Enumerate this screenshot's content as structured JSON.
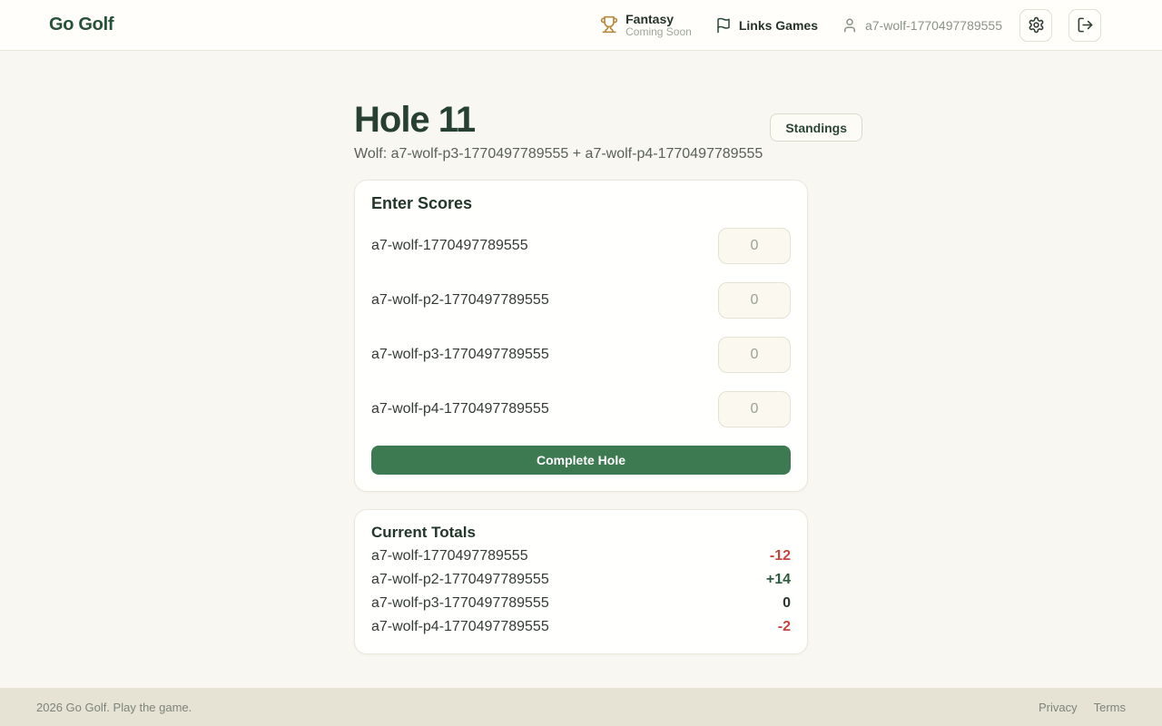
{
  "brand": "Go Golf",
  "nav": {
    "fantasy": {
      "label": "Fantasy",
      "sublabel": "Coming Soon"
    },
    "links_games_label": "Links Games",
    "user": "a7-wolf-1770497789555"
  },
  "page": {
    "title": "Hole 11",
    "subtitle": "Wolf: a7-wolf-p3-1770497789555 + a7-wolf-p4-1770497789555",
    "standings_label": "Standings"
  },
  "enter_scores": {
    "title": "Enter Scores",
    "submit_label": "Complete Hole",
    "players": [
      {
        "name": "a7-wolf-1770497789555",
        "placeholder": "0",
        "value": ""
      },
      {
        "name": "a7-wolf-p2-1770497789555",
        "placeholder": "0",
        "value": ""
      },
      {
        "name": "a7-wolf-p3-1770497789555",
        "placeholder": "0",
        "value": ""
      },
      {
        "name": "a7-wolf-p4-1770497789555",
        "placeholder": "0",
        "value": ""
      }
    ]
  },
  "totals": {
    "title": "Current Totals",
    "rows": [
      {
        "name": "a7-wolf-1770497789555",
        "value": "-12",
        "status": "negative"
      },
      {
        "name": "a7-wolf-p2-1770497789555",
        "value": "+14",
        "status": "positive"
      },
      {
        "name": "a7-wolf-p3-1770497789555",
        "value": "0",
        "status": "even"
      },
      {
        "name": "a7-wolf-p4-1770497789555",
        "value": "-2",
        "status": "negative"
      }
    ]
  },
  "footer": {
    "copyright": "2026 Go Golf. Play the game.",
    "links": [
      "Privacy",
      "Terms"
    ]
  },
  "icons": {
    "trophy": "trophy-icon",
    "flag": "flag-icon",
    "user": "user-icon",
    "gear": "gear-icon",
    "logout": "logout-icon"
  },
  "colors": {
    "accent_green": "#3e7a51",
    "brand_green": "#265136",
    "negative": "#c6453e",
    "positive": "#2d5c3f",
    "trophy_gold": "#b5893c",
    "footer_bg": "#e6e3d5"
  }
}
